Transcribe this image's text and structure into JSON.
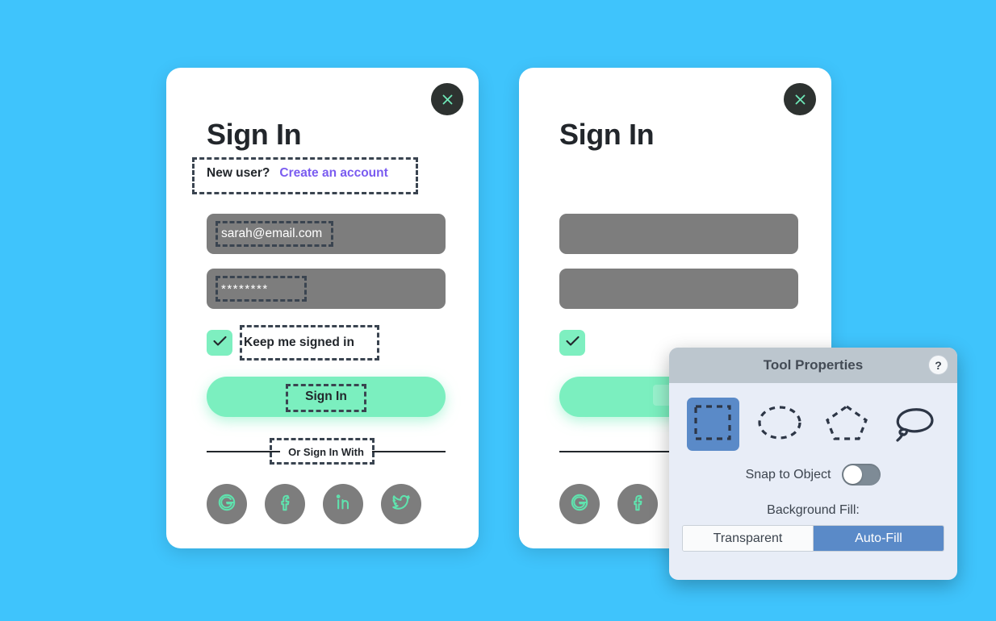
{
  "background_color": "#3fc4fc",
  "accent_mint": "#7befbf",
  "accent_purple": "#7a5cf0",
  "accent_blue": "#5a8ac8",
  "cards": {
    "annotated": {
      "title": "Sign In",
      "new_user_prompt": "New user?",
      "create_account_link": "Create an account",
      "email_value": "sarah@email.com",
      "password_value": "********",
      "keep_signed_in_label": "Keep me signed in",
      "signin_button_label": "Sign In",
      "divider_label": "Or Sign In With",
      "close_icon": "close-icon",
      "socials": [
        {
          "name": "google-icon",
          "label": "G"
        },
        {
          "name": "facebook-icon",
          "label": "f"
        },
        {
          "name": "linkedin-icon",
          "label": "in"
        },
        {
          "name": "twitter-icon",
          "label": "bird"
        }
      ]
    },
    "plain": {
      "title": "Sign In",
      "close_icon": "close-icon",
      "socials": [
        {
          "name": "google-icon",
          "label": "G"
        },
        {
          "name": "facebook-icon",
          "label": "f"
        }
      ]
    }
  },
  "tool_panel": {
    "title": "Tool Properties",
    "help_label": "?",
    "tools": [
      {
        "name": "rectangular-marquee-tool",
        "selected": true
      },
      {
        "name": "elliptical-marquee-tool",
        "selected": false
      },
      {
        "name": "polygonal-lasso-tool",
        "selected": false
      },
      {
        "name": "freehand-lasso-tool",
        "selected": false
      }
    ],
    "snap_label": "Snap to Object",
    "snap_enabled": false,
    "background_fill_label": "Background Fill:",
    "fill_options": [
      {
        "label": "Transparent",
        "active": false
      },
      {
        "label": "Auto-Fill",
        "active": true
      }
    ]
  }
}
